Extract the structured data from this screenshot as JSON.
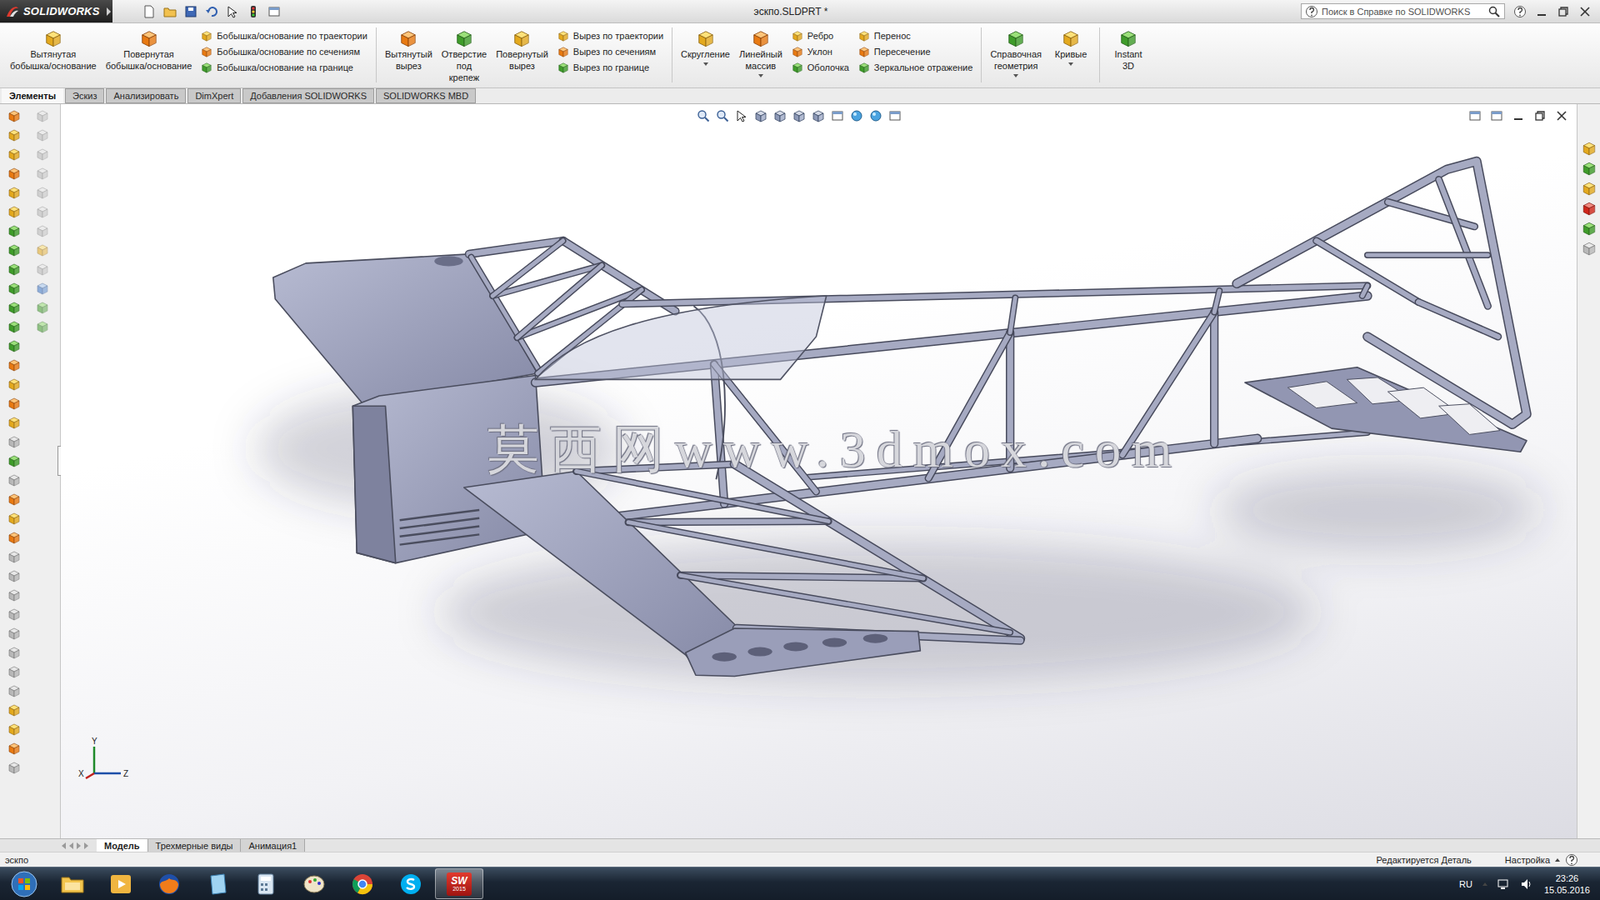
{
  "window": {
    "title": "эскпо.SLDPRT *",
    "logo": "SOLIDWORKS",
    "search_placeholder": "Поиск в Справке по SOLIDWORKS"
  },
  "ribbon": [
    {
      "kind": "large",
      "lines": [
        "Вытянутая",
        "бобышка/основание"
      ],
      "dropdown": false
    },
    {
      "kind": "large",
      "lines": [
        "Повернутая",
        "бобышка/основание"
      ],
      "dropdown": false
    },
    {
      "kind": "stack",
      "items": [
        "Бобышка/основание по траектории",
        "Бобышка/основание по сечениям",
        "Бобышка/основание на границе"
      ]
    },
    {
      "kind": "separator"
    },
    {
      "kind": "large",
      "lines": [
        "Вытянутый",
        "вырез"
      ],
      "dropdown": false
    },
    {
      "kind": "large",
      "lines": [
        "Отверстие",
        "под",
        "крепеж"
      ],
      "dropdown": false
    },
    {
      "kind": "large",
      "lines": [
        "Повернутый",
        "вырез"
      ],
      "dropdown": false
    },
    {
      "kind": "stack",
      "items": [
        "Вырез по траектории",
        "Вырез по сечениям",
        "Вырез по границе"
      ]
    },
    {
      "kind": "separator"
    },
    {
      "kind": "large",
      "lines": [
        "Скругление"
      ],
      "dropdown": true
    },
    {
      "kind": "large",
      "lines": [
        "Линейный",
        "массив"
      ],
      "dropdown": true
    },
    {
      "kind": "stack",
      "items": [
        "Ребро",
        "Уклон",
        "Оболочка"
      ]
    },
    {
      "kind": "stack",
      "items": [
        "Перенос",
        "Пересечение",
        "Зеркальное отражение"
      ]
    },
    {
      "kind": "separator"
    },
    {
      "kind": "large",
      "lines": [
        "Справочная",
        "геометрия"
      ],
      "dropdown": true
    },
    {
      "kind": "large",
      "lines": [
        "Кривые"
      ],
      "dropdown": true
    },
    {
      "kind": "separator"
    },
    {
      "kind": "large",
      "lines": [
        "Instant",
        "3D"
      ],
      "dropdown": false
    }
  ],
  "tabs": [
    {
      "label": "Элементы",
      "selected": true
    },
    {
      "label": "Эскиз",
      "selected": false
    },
    {
      "label": "Анализировать",
      "selected": false
    },
    {
      "label": "DimXpert",
      "selected": false
    },
    {
      "label": "Добавления SOLIDWORKS",
      "selected": false
    },
    {
      "label": "SOLIDWORKS MBD",
      "selected": false
    }
  ],
  "watermark": "莫西网www.3dmox.com",
  "triad": [
    {
      "label": "Y",
      "color": "#1f8a2a"
    },
    {
      "label": "Z",
      "color": "#1d4fa8"
    },
    {
      "label": "X",
      "color": "#c0201c"
    }
  ],
  "bottom_tabs": [
    {
      "label": "Модель",
      "selected": true
    },
    {
      "label": "Трехмерные виды",
      "selected": false
    },
    {
      "label": "Анимация1",
      "selected": false
    }
  ],
  "status_bar": {
    "document": "эскпо",
    "mode": "Редактируется Деталь",
    "settings": "Настройка"
  },
  "taskbar": {
    "apps": [
      {
        "kind": "start",
        "active": false
      },
      {
        "kind": "explorer",
        "active": false
      },
      {
        "kind": "media",
        "active": false
      },
      {
        "kind": "firefox",
        "active": false
      },
      {
        "kind": "notepad",
        "active": false
      },
      {
        "kind": "calc",
        "active": false
      },
      {
        "kind": "paint",
        "active": false
      },
      {
        "kind": "chrome",
        "active": false
      },
      {
        "kind": "skype",
        "active": false
      },
      {
        "kind": "solidworks",
        "active": true,
        "text": "SW",
        "badge": "2015"
      }
    ],
    "language": "RU",
    "time": "23:26",
    "date": "15.05.2016"
  }
}
